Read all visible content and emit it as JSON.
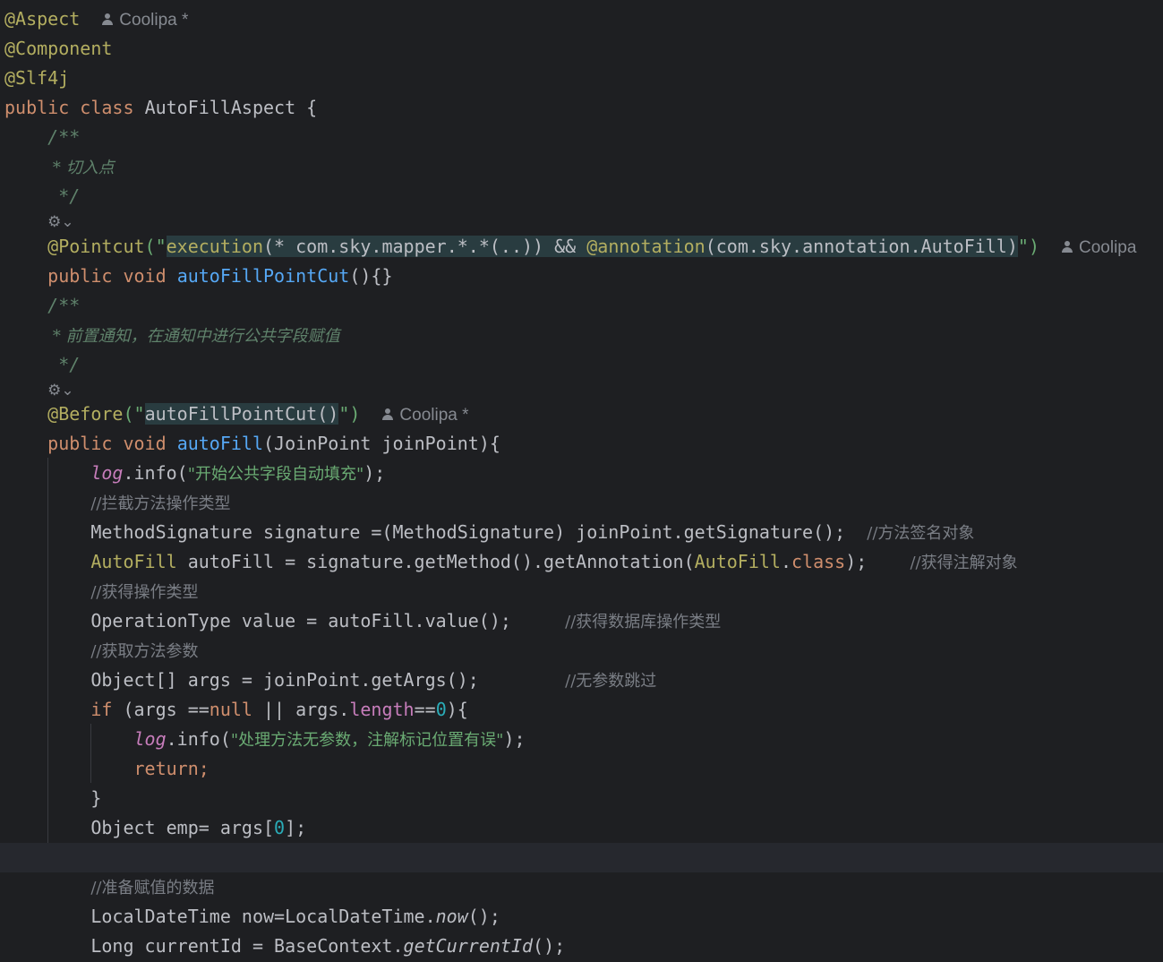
{
  "author_hint": "Coolipa",
  "author_hint_modified": "Coolipa *",
  "gutter_icon": "aop-advice-icon",
  "code": {
    "ann_aspect": "@Aspect",
    "ann_component": "@Component",
    "ann_slf4j": "@Slf4j",
    "kw_public": "public",
    "kw_class": "class",
    "kw_void": "void",
    "kw_if": "if",
    "kw_null": "null",
    "kw_return": "return;",
    "kw_dot_class": "class",
    "class_name": "AutoFillAspect",
    "brace_open": " {",
    "doc_open": "/**",
    "doc_pointcut": " * 切入点",
    "doc_close": " */",
    "doc_before": " * 前置通知，在通知中进行公共字段赋值",
    "ann_pointcut": "@Pointcut",
    "pc_quote_open": "(\"",
    "pc_execution": "execution",
    "pc_expr": "(* com.sky.mapper.*.*(..)) && ",
    "pc_annotation": "@annotation",
    "pc_expr2": "(com.sky.annotation.AutoFill)",
    "pc_quote_close": "\")",
    "fn_pointcut": "autoFillPointCut",
    "pointcut_tail": "(){}",
    "ann_before": "@Before",
    "before_quote_open": "(\"",
    "before_value": "autoFillPointCut()",
    "before_quote_close": "\")",
    "fn_autofill": "autoFill",
    "autofill_params": "(JoinPoint joinPoint){",
    "log": "log",
    "info_open": ".info(",
    "str_start": "\"开始公共字段自动填充\"",
    "semi_close": ");",
    "cmt_intercept": "//拦截方法操作类型",
    "sig_decl": "MethodSignature signature =(MethodSignature) joinPoint.getSignature();",
    "cmt_sig": "//方法签名对象",
    "autofill_type": "AutoFill",
    "autofill_decl_mid": " autoFill = signature.getMethod().getAnnotation(",
    "autofill_decl_end": ");",
    "cmt_annotation_obj": "//获得注解对象",
    "cmt_optype": "//获得操作类型",
    "optype_decl": "OperationType value = autoFill.value();",
    "cmt_db_optype": "//获得数据库操作类型",
    "cmt_get_params": "//获取方法参数",
    "args_decl": "Object[] args = joinPoint.getArgs();",
    "cmt_no_params": "//无参数跳过",
    "if_cond_1": " (args ==",
    "if_cond_2": " || args.",
    "length": "length",
    "eqeq": "==",
    "zero": "0",
    "if_close": "){",
    "str_no_params": "\"处理方法无参数，注解标记位置有误\"",
    "close_brace": "}",
    "emp_decl_1": "Object emp= args[",
    "emp_decl_2": "];",
    "cmt_prepare": "//准备赋值的数据",
    "now_decl_1": "LocalDateTime now=LocalDateTime.",
    "now_fn": "now",
    "call_end": "();",
    "cur_decl_1": "Long currentId = BaseContext.",
    "cur_fn": "getCurrentId"
  }
}
